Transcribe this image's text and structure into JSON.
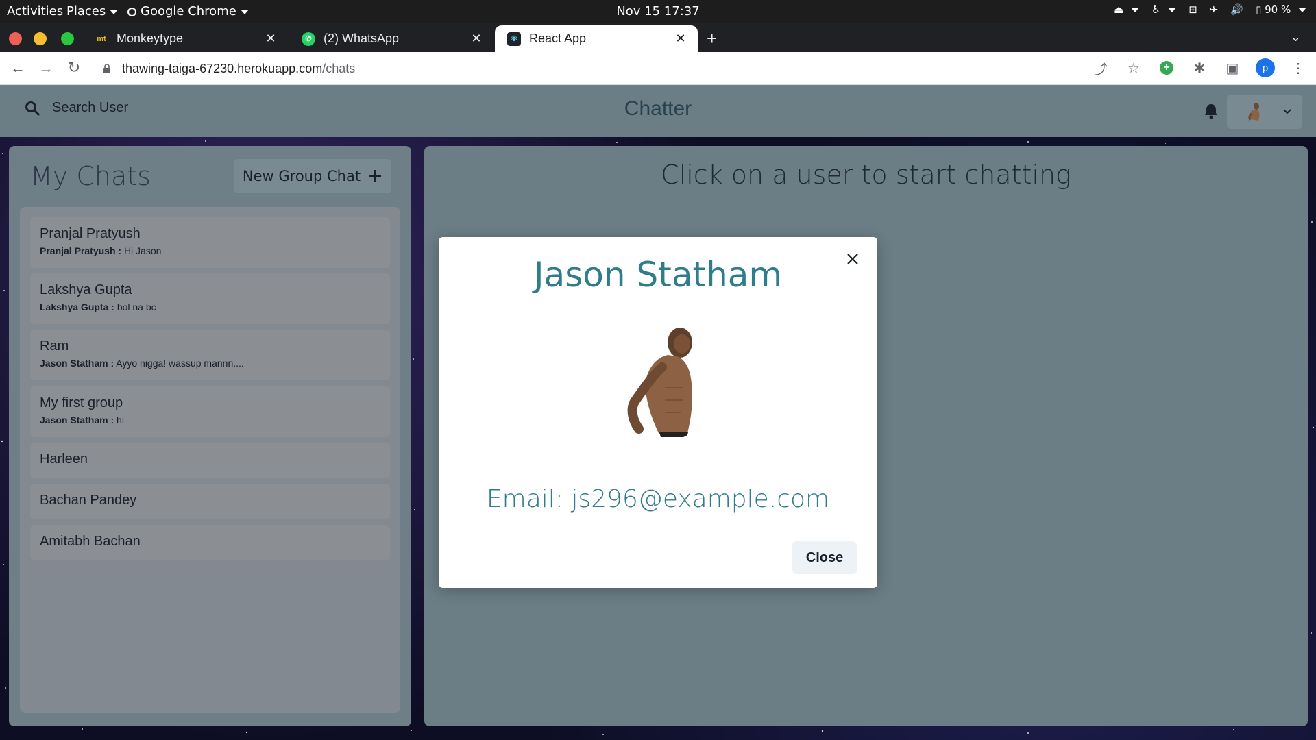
{
  "os_bar": {
    "activities": "Activities",
    "places": "Places",
    "app_name": "Google Chrome",
    "datetime": "Nov 15  17:37",
    "battery": "90 %"
  },
  "browser": {
    "tabs": [
      {
        "title": "Monkeytype",
        "favicon": "mt",
        "active": false
      },
      {
        "title": "(2) WhatsApp",
        "favicon": "whatsapp-icon",
        "active": false
      },
      {
        "title": "React App",
        "favicon": "react-icon",
        "active": true
      }
    ],
    "url_host": "thawing-taiga-67230.herokuapp.com",
    "url_path": "/chats",
    "profile_initial": "p"
  },
  "header": {
    "search_label": "Search User",
    "brand": "Chatter"
  },
  "my_chats": {
    "title": "My Chats",
    "new_group_label": "New Group Chat",
    "chats": [
      {
        "name": "Pranjal Pratyush",
        "sender": "Pranjal Pratyush :",
        "message": "Hi Jason"
      },
      {
        "name": "Lakshya Gupta",
        "sender": "Lakshya Gupta :",
        "message": "bol na bc"
      },
      {
        "name": "Ram",
        "sender": "Jason Statham :",
        "message": "Ayyo nigga! wassup mannn...."
      },
      {
        "name": "My first group",
        "sender": "Jason Statham :",
        "message": "hi"
      },
      {
        "name": "Harleen",
        "sender": "",
        "message": ""
      },
      {
        "name": "Bachan Pandey",
        "sender": "",
        "message": ""
      },
      {
        "name": "Amitabh Bachan",
        "sender": "",
        "message": ""
      }
    ]
  },
  "chat_area": {
    "placeholder": "Click on a user to start chatting"
  },
  "modal": {
    "name": "Jason Statham",
    "email": "Email: js296@example.com",
    "close_label": "Close"
  },
  "colors": {
    "accent": "#2f7c8c",
    "header_bg": "#6b7d85",
    "panel_bg": "#6f7f87"
  }
}
